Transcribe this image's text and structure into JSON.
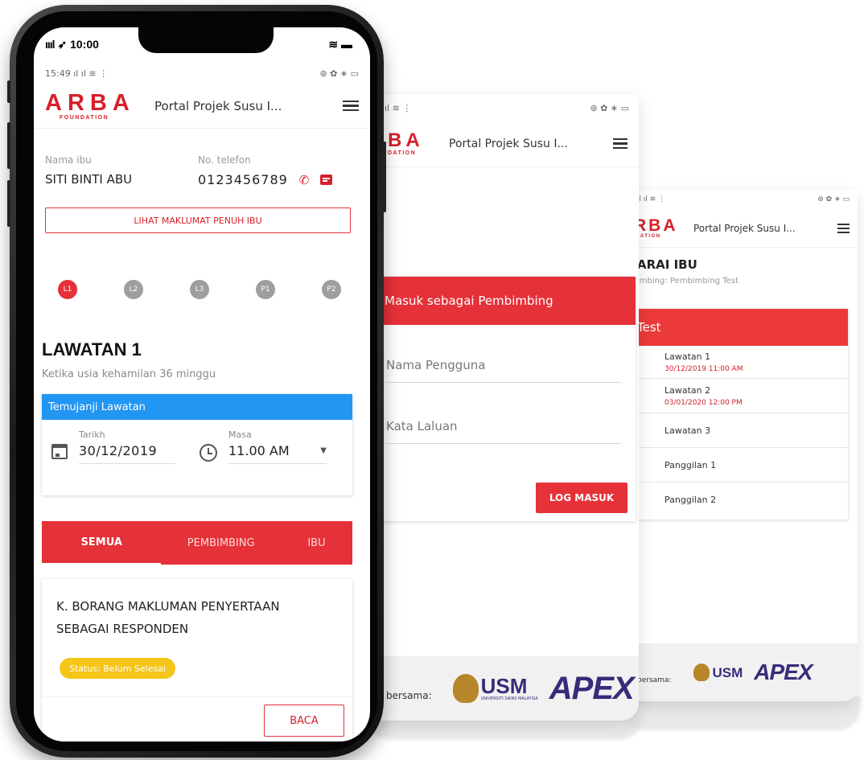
{
  "brand": {
    "logo": "ARBA",
    "logo_sub": "FOUNDATION",
    "red": "#e53138"
  },
  "app_title": "Portal Projek Susu I...",
  "back_screen": {
    "status_time": "",
    "section_title": "ARAI IBU",
    "subtitle": "imbing: Pembimbing Test",
    "group_header": "Test",
    "rows": [
      {
        "label": "Lawatan 1",
        "date": "30/12/2019 11:00 AM"
      },
      {
        "label": "Lawatan 2",
        "date": "03/01/2020 12:00 PM"
      },
      {
        "label": "Lawatan 3",
        "date": ""
      },
      {
        "label": "Panggilan 1",
        "date": ""
      },
      {
        "label": "Panggilan 2",
        "date": ""
      }
    ],
    "footer_label": "bersama:"
  },
  "login_screen": {
    "logo_partial": "BA",
    "logo_sub_partial": "DATION",
    "header": "Masuk sebagai Pembimbing",
    "username_placeholder": "Nama Pengguna",
    "password_placeholder": "Kata Laluan",
    "login_button": "LOG MASUK",
    "footer_label": "bersama:"
  },
  "footer_logos": {
    "usm": "USM",
    "usm_sub": "UNIVERSITI SAINS MALAYSIA",
    "apex": "APEX"
  },
  "phone": {
    "ios_time": "10:00",
    "android_time": "15:49",
    "mother_name_label": "Nama ibu",
    "mother_name": "SITI BINTI ABU",
    "phone_label": "No. telefon",
    "phone_number": "0123456789",
    "view_full_button": "LIHAT MAKLUMAT PENUH IBU",
    "steps": [
      "L1",
      "L2",
      "L3",
      "P1",
      "P2"
    ],
    "active_step": 0,
    "visit_title": "LAWATAN 1",
    "visit_sub": "Ketika usia kehamilan 36 minggu",
    "appointment_header": "Temujanji Lawatan",
    "date_label": "Tarikh",
    "date_value": "30/12/2019",
    "time_label": "Masa",
    "time_value": "11.00 AM",
    "tabs": [
      "SEMUA",
      "PEMBIMBING",
      "IBU"
    ],
    "active_tab": 0,
    "form_title_line1": "K. BORANG MAKLUMAN PENYERTAAN",
    "form_title_line2": "SEBAGAI RESPONDEN",
    "status_pill": "Status: Belum Selesai",
    "read_button": "BACA",
    "pill_color": "#f5c518",
    "blue_header": "#2196f3"
  }
}
